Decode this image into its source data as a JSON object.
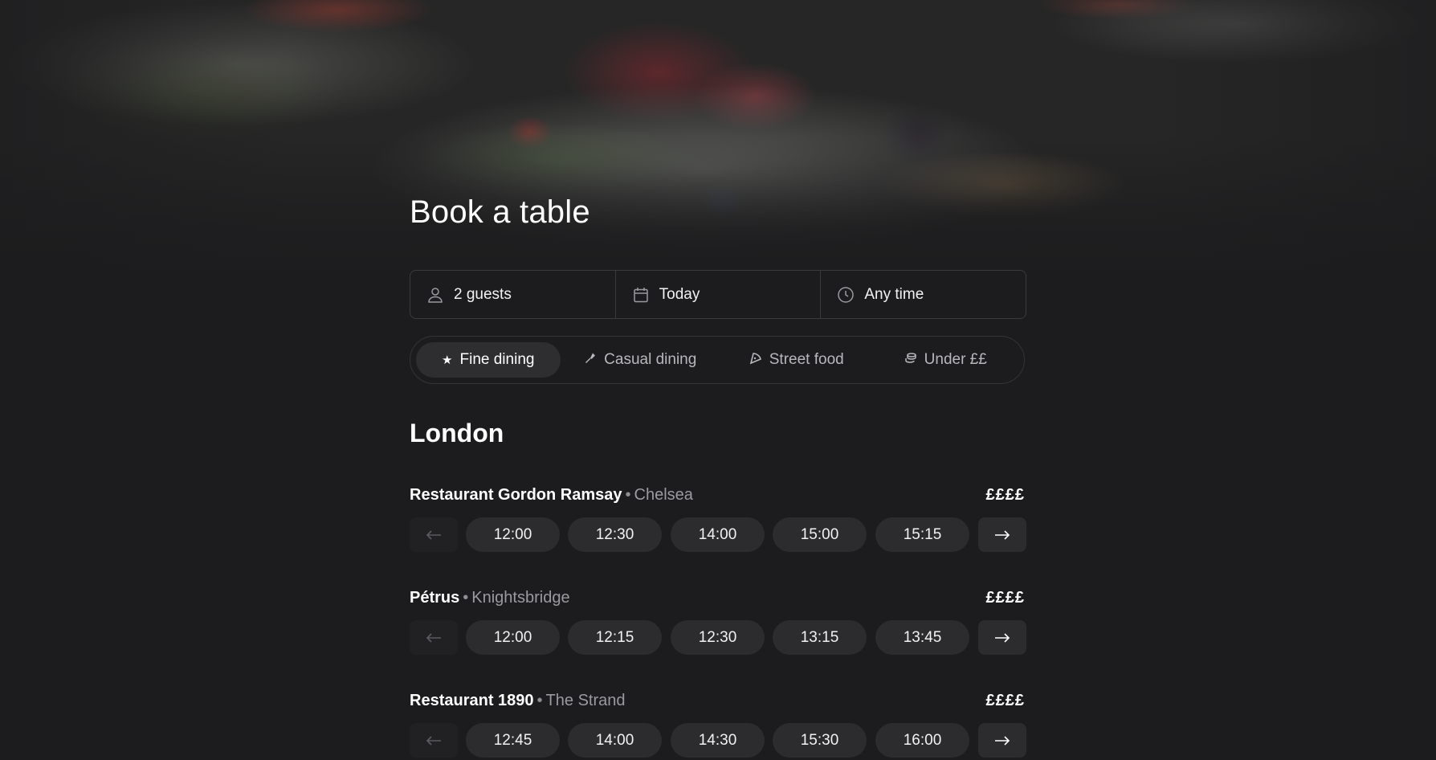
{
  "page": {
    "title": "Book a table"
  },
  "search": {
    "guests": "2 guests",
    "date": "Today",
    "time": "Any time"
  },
  "categories": [
    {
      "label": "Fine dining",
      "icon": "star-icon",
      "active": true
    },
    {
      "label": "Casual dining",
      "icon": "utensil-icon",
      "active": false
    },
    {
      "label": "Street food",
      "icon": "pizza-icon",
      "active": false
    },
    {
      "label": "Under ££",
      "icon": "coins-icon",
      "active": false
    }
  ],
  "city": "London",
  "restaurants": [
    {
      "name": "Restaurant Gordon Ramsay",
      "area": "Chelsea",
      "price": "££££",
      "times": [
        "12:00",
        "12:30",
        "14:00",
        "15:00",
        "15:15"
      ]
    },
    {
      "name": "Pétrus",
      "area": "Knightsbridge",
      "price": "££££",
      "times": [
        "12:00",
        "12:15",
        "12:30",
        "13:15",
        "13:45"
      ]
    },
    {
      "name": "Restaurant 1890",
      "area": "The Strand",
      "price": "££££",
      "times": [
        "12:45",
        "14:00",
        "14:30",
        "15:30",
        "16:00"
      ]
    }
  ],
  "colors": {
    "background": "#1c1c1e",
    "slot_bg": "#2c2c2f",
    "border": "#3a3a3d",
    "text_muted": "#9a9a9f"
  }
}
